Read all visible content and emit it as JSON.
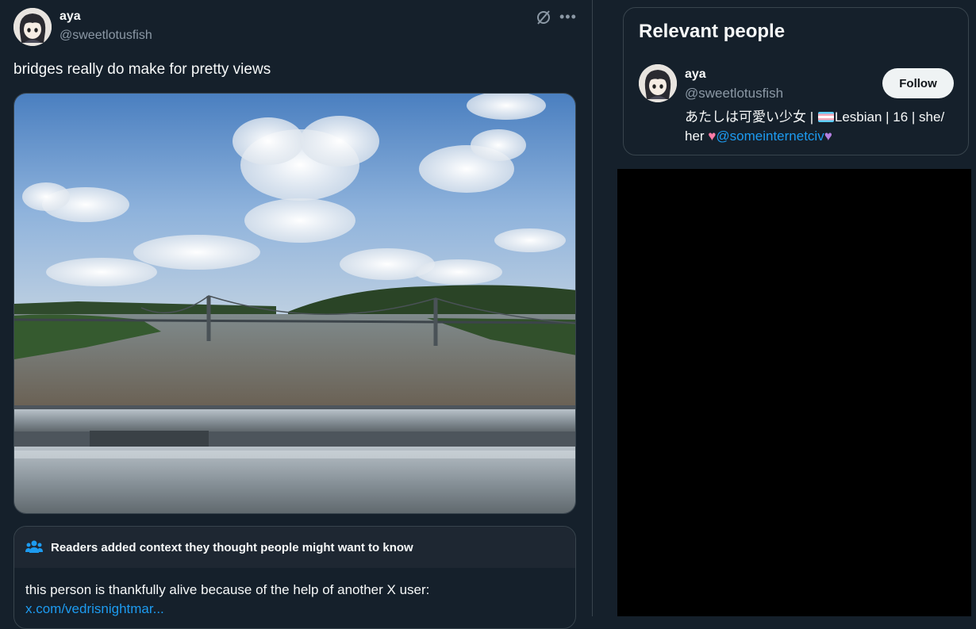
{
  "post": {
    "author_name": "aya",
    "author_handle": "@sweetlotusfish",
    "text": "bridges really do make for pretty views",
    "more_label": "•••",
    "icons": [
      "grok-icon",
      "more-icon"
    ]
  },
  "community_note": {
    "title": "Readers added context they thought people might want to know",
    "body": "this person is thankfully alive because of the help of another X user:",
    "link": "x.com/vedrisnightmar..."
  },
  "sidebar": {
    "title": "Relevant people",
    "person": {
      "name": "aya",
      "handle": "@sweetlotusfish",
      "follow_label": "Follow",
      "bio_part1": "あたしは可愛い少女 | ",
      "bio_part2": "Lesbian | 16 | she/ her ",
      "bio_heart1": "♥",
      "bio_link": "@someinternetciv",
      "bio_heart2": "♥"
    }
  },
  "colors": {
    "background": "#15202b",
    "accent": "#1d9bf0",
    "border": "#38444d",
    "secondary_text": "#8b98a5"
  }
}
